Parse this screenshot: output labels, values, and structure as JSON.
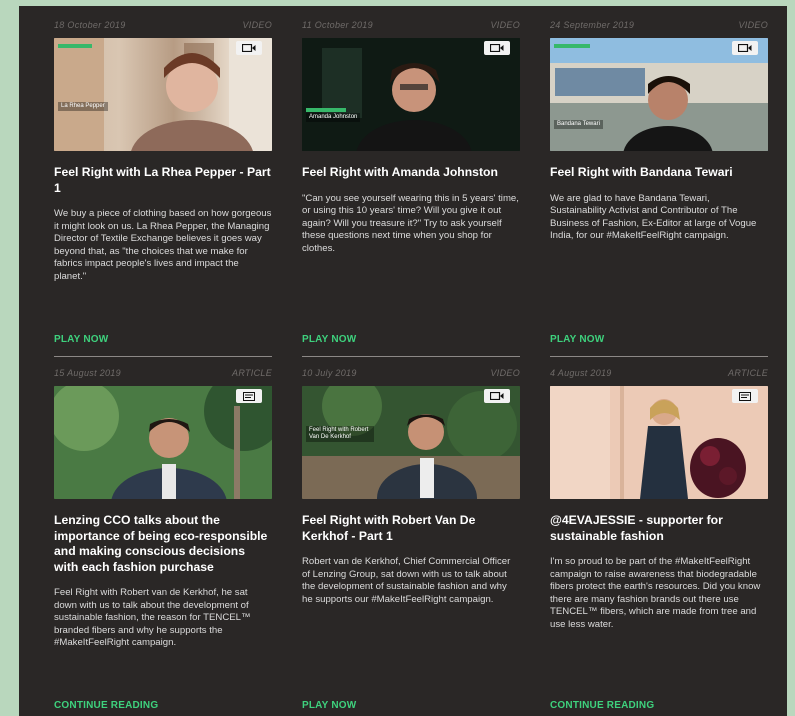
{
  "cards": [
    {
      "date": "18 October 2019",
      "type": "VIDEO",
      "title": "Feel Right with La Rhea Pepper - Part 1",
      "description": "We buy a piece of clothing based on how gorgeous it might look on us. La Rhea Pepper, the Managing Director of Textile Exchange believes it goes way beyond that, as \"the choices that we make for fabrics impact people's lives and impact the planet.\"",
      "cta": "PLAY NOW",
      "overlay_text": "La Rhea Pepper",
      "badge_icon": "video-camera-icon"
    },
    {
      "date": "11 October 2019",
      "type": "VIDEO",
      "title": "Feel Right with Amanda Johnston",
      "description": "\"Can you see yourself wearing this in 5 years' time, or using this 10 years' time? Will you give it out again? Will you treasure it?\" Try to ask yourself these questions next time when you shop for clothes.",
      "cta": "PLAY NOW",
      "overlay_text": "Amanda Johnston",
      "badge_icon": "video-camera-icon"
    },
    {
      "date": "24 September 2019",
      "type": "VIDEO",
      "title": "Feel Right with Bandana Tewari",
      "description": "We are glad to have Bandana Tewari, Sustainability Activist and Contributor of The Business of Fashion, Ex-Editor at large of Vogue India, for our #MakeItFeelRight campaign.",
      "cta": "PLAY NOW",
      "overlay_text": "Bandana Tewari",
      "badge_icon": "video-camera-icon"
    },
    {
      "date": "15 August 2019",
      "type": "ARTICLE",
      "title": "Lenzing CCO talks about the importance of being eco-responsible and making conscious decisions with each fashion purchase",
      "description": "Feel Right with Robert van de Kerkhof, he sat down with us to talk about the development of sustainable fashion, the reason for TENCEL™ branded fibers and why he supports the #MakeItFeelRight campaign.",
      "cta": "CONTINUE READING",
      "overlay_text": "",
      "badge_icon": "article-icon"
    },
    {
      "date": "10 July 2019",
      "type": "VIDEO",
      "title": "Feel Right with Robert Van De Kerkhof - Part 1",
      "description": "Robert van de Kerkhof, Chief Commercial Officer of Lenzing Group, sat down with us to talk about the development of sustainable fashion and why he supports our #MakeItFeelRight campaign.",
      "cta": "PLAY NOW",
      "overlay_text": "Feel Right with Robert Van De Kerkhof",
      "badge_icon": "video-camera-icon"
    },
    {
      "date": "4 August 2019",
      "type": "ARTICLE",
      "title": "@4EVAJESSIE - supporter for sustainable fashion",
      "description": "I'm so proud to be part of the #MakeItFeelRight campaign to raise awareness that biodegradable fibers protect the earth's resources. Did you know there are many fashion brands out there use TENCEL™ fibers, which are made from tree and use less water.",
      "cta": "CONTINUE READING",
      "overlay_text": "",
      "badge_icon": "article-icon"
    }
  ]
}
